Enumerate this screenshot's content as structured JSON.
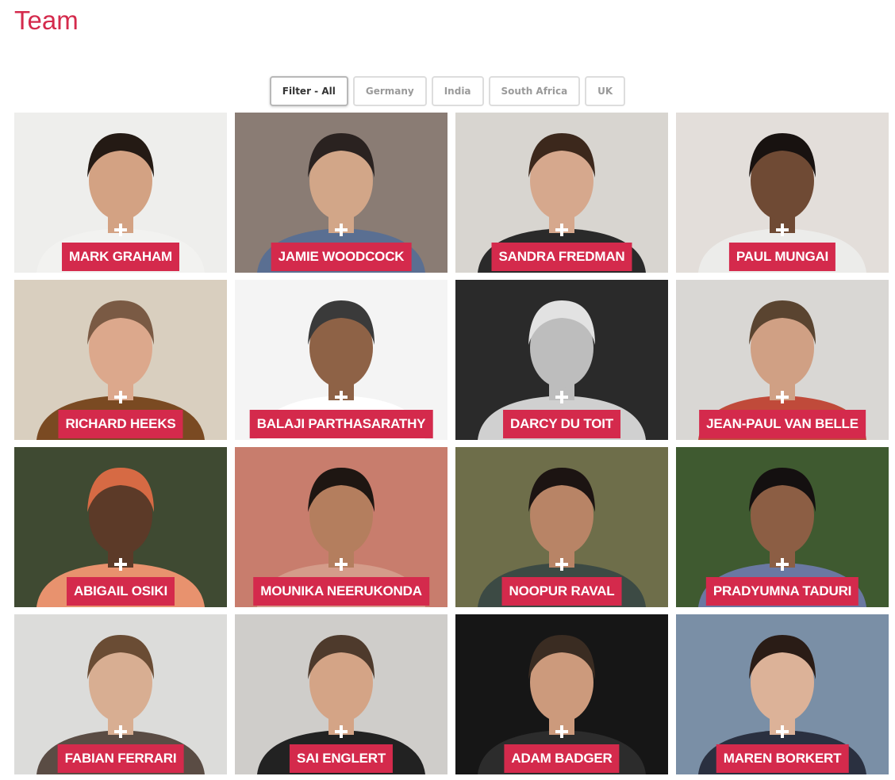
{
  "page": {
    "title": "Team"
  },
  "filters": [
    {
      "label": "Filter - All",
      "active": true
    },
    {
      "label": "Germany",
      "active": false
    },
    {
      "label": "India",
      "active": false
    },
    {
      "label": "South Africa",
      "active": false
    },
    {
      "label": "UK",
      "active": false
    }
  ],
  "team": [
    {
      "name": "MARK GRAHAM",
      "bg": "#eeeeec",
      "skin": "#d3a283",
      "hair": "#241a14",
      "shirt": "#f2f2f0"
    },
    {
      "name": "JAMIE WOODCOCK",
      "bg": "#8a7c74",
      "skin": "#d2a688",
      "hair": "#2a2220",
      "shirt": "#5a6f92"
    },
    {
      "name": "SANDRA FREDMAN",
      "bg": "#d8d5d0",
      "skin": "#d6a88d",
      "hair": "#3c281c",
      "shirt": "#2a2a2a"
    },
    {
      "name": "PAUL MUNGAI",
      "bg": "#e3deda",
      "skin": "#6f4a34",
      "hair": "#181210",
      "shirt": "#ececea"
    },
    {
      "name": "RICHARD HEEKS",
      "bg": "#d9cfbf",
      "skin": "#dca88c",
      "hair": "#7a5a44",
      "shirt": "#7a4a22"
    },
    {
      "name": "BALAJI PARTHASARATHY",
      "bg": "#f4f4f4",
      "skin": "#8e6246",
      "hair": "#3a3a3a",
      "shirt": "#ffffff"
    },
    {
      "name": "DARCY DU TOIT",
      "bg": "#2a2a2a",
      "skin": "#bdbdbd",
      "hair": "#e2e2e2",
      "shirt": "#d0d0d0"
    },
    {
      "name": "JEAN-PAUL VAN BELLE",
      "bg": "#d9d7d4",
      "skin": "#d0a084",
      "hair": "#5a4430",
      "shirt": "#c04a3a"
    },
    {
      "name": "ABIGAIL OSIKI",
      "bg": "#3f4a32",
      "skin": "#5c3a28",
      "hair": "#d66a44",
      "shirt": "#e8926e"
    },
    {
      "name": "MOUNIKA NEERUKONDA",
      "bg": "#c87d6d",
      "skin": "#b47e5e",
      "hair": "#1e1612",
      "shirt": "#d49c8a"
    },
    {
      "name": "NOOPUR RAVAL",
      "bg": "#6e6e4a",
      "skin": "#b88466",
      "hair": "#1c1412",
      "shirt": "#3c4a44"
    },
    {
      "name": "PRADYUMNA TADURI",
      "bg": "#3f5a30",
      "skin": "#8c5e44",
      "hair": "#141010",
      "shirt": "#6a78a2"
    },
    {
      "name": "FABIAN FERRARI",
      "bg": "#dcdcda",
      "skin": "#d8ae92",
      "hair": "#6a4c34",
      "shirt": "#5a4c44"
    },
    {
      "name": "SAI ENGLERT",
      "bg": "#cfcdca",
      "skin": "#d4a486",
      "hair": "#4e3a2c",
      "shirt": "#222222"
    },
    {
      "name": "ADAM BADGER",
      "bg": "#161616",
      "skin": "#cc9a7c",
      "hair": "#3a2c22",
      "shirt": "#2c2c2c"
    },
    {
      "name": "MAREN BORKERT",
      "bg": "#7a8fa6",
      "skin": "#dcb298",
      "hair": "#2a1c16",
      "shirt": "#2a3040"
    }
  ]
}
